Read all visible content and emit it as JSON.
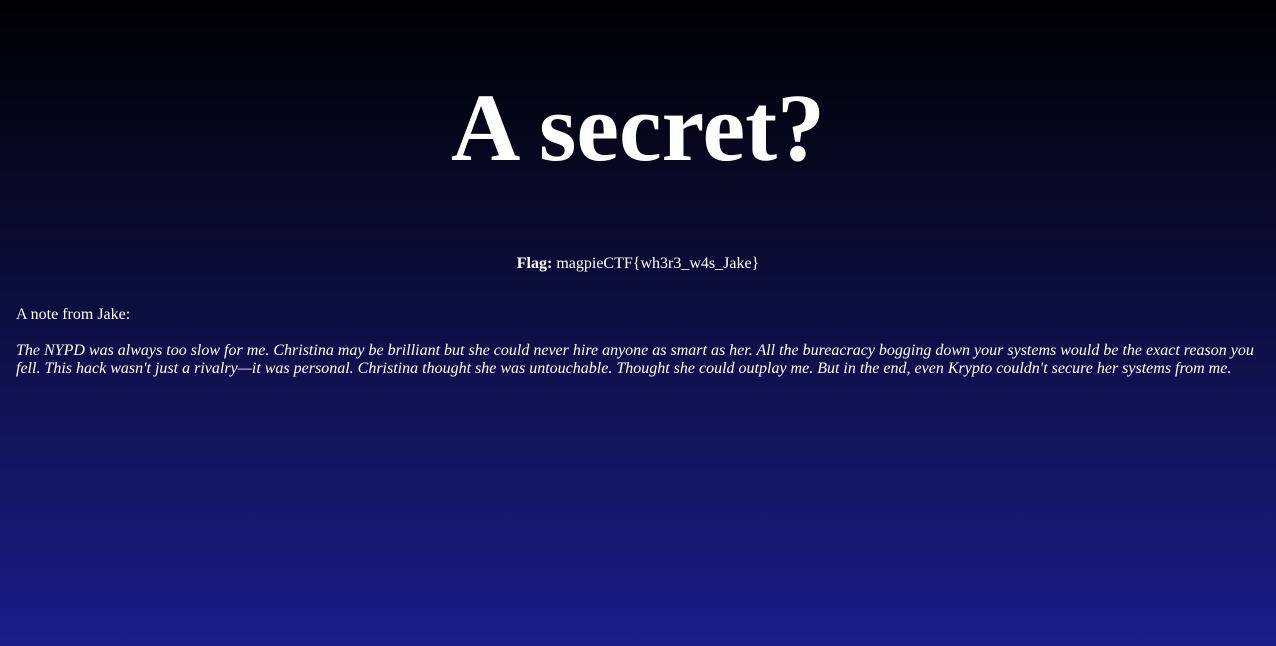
{
  "page": {
    "title": "A secret?",
    "flag_label": "Flag:",
    "flag_value": "magpieCTF{wh3r3_w4s_Jake}",
    "note_heading": "A note from Jake:",
    "note_body": "The NYPD was always too slow for me. Christina may be brilliant but she could never hire anyone as smart as her. All the bureacracy bogging down your systems would be the exact reason you fell. This hack wasn't just a rivalry—it was personal. Christina thought she was untouchable. Thought she could outplay me. But in the end, even Krypto couldn't secure her systems from me."
  },
  "colors": {
    "background_top": "#000000",
    "background_bottom": "#1b1c88",
    "text": "#ffffff"
  }
}
